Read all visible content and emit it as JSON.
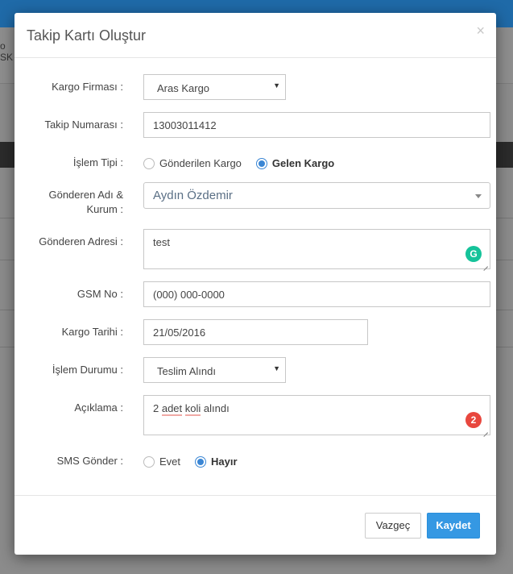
{
  "background": {
    "text_lines": [
      "o",
      "SK"
    ]
  },
  "modal": {
    "title": "Takip Kartı Oluştur",
    "close_glyph": "×"
  },
  "form": {
    "kargo_firmasi": {
      "label": "Kargo Firması :",
      "value": "Aras Kargo",
      "arrow": "▼"
    },
    "takip_numarasi": {
      "label": "Takip Numarası :",
      "value": "13003011412"
    },
    "islem_tipi": {
      "label": "İşlem Tipi :",
      "options": [
        {
          "label": "Gönderilen Kargo",
          "checked": false
        },
        {
          "label": "Gelen Kargo",
          "checked": true
        }
      ]
    },
    "gonderen_adi": {
      "label_line1": "Gönderen Adı &",
      "label_line2": "Kurum :",
      "value": "Aydın Özdemir"
    },
    "gonderen_adresi": {
      "label": "Gönderen Adresi :",
      "value": "test",
      "icon": "grammarly-icon",
      "icon_glyph": "G"
    },
    "gsm_no": {
      "label": "GSM No :",
      "value": "(000) 000-0000"
    },
    "kargo_tarihi": {
      "label": "Kargo Tarihi :",
      "value": "21/05/2016"
    },
    "islem_durumu": {
      "label": "İşlem Durumu :",
      "value": "Teslim Alındı",
      "arrow": "▼"
    },
    "aciklama": {
      "label": "Açıklama :",
      "value_parts": [
        "2 ",
        "adet",
        " ",
        "koli",
        " alındı"
      ],
      "badge": "2"
    },
    "sms_gonder": {
      "label": "SMS Gönder :",
      "options": [
        {
          "label": "Evet",
          "checked": false
        },
        {
          "label": "Hayır",
          "checked": true
        }
      ]
    }
  },
  "footer": {
    "cancel_label": "Vazgeç",
    "save_label": "Kaydet"
  },
  "colors": {
    "accent": "#3598e3",
    "radio_checked": "#3a86d4",
    "grammarly": "#15c39a",
    "badge": "#e8473e"
  }
}
